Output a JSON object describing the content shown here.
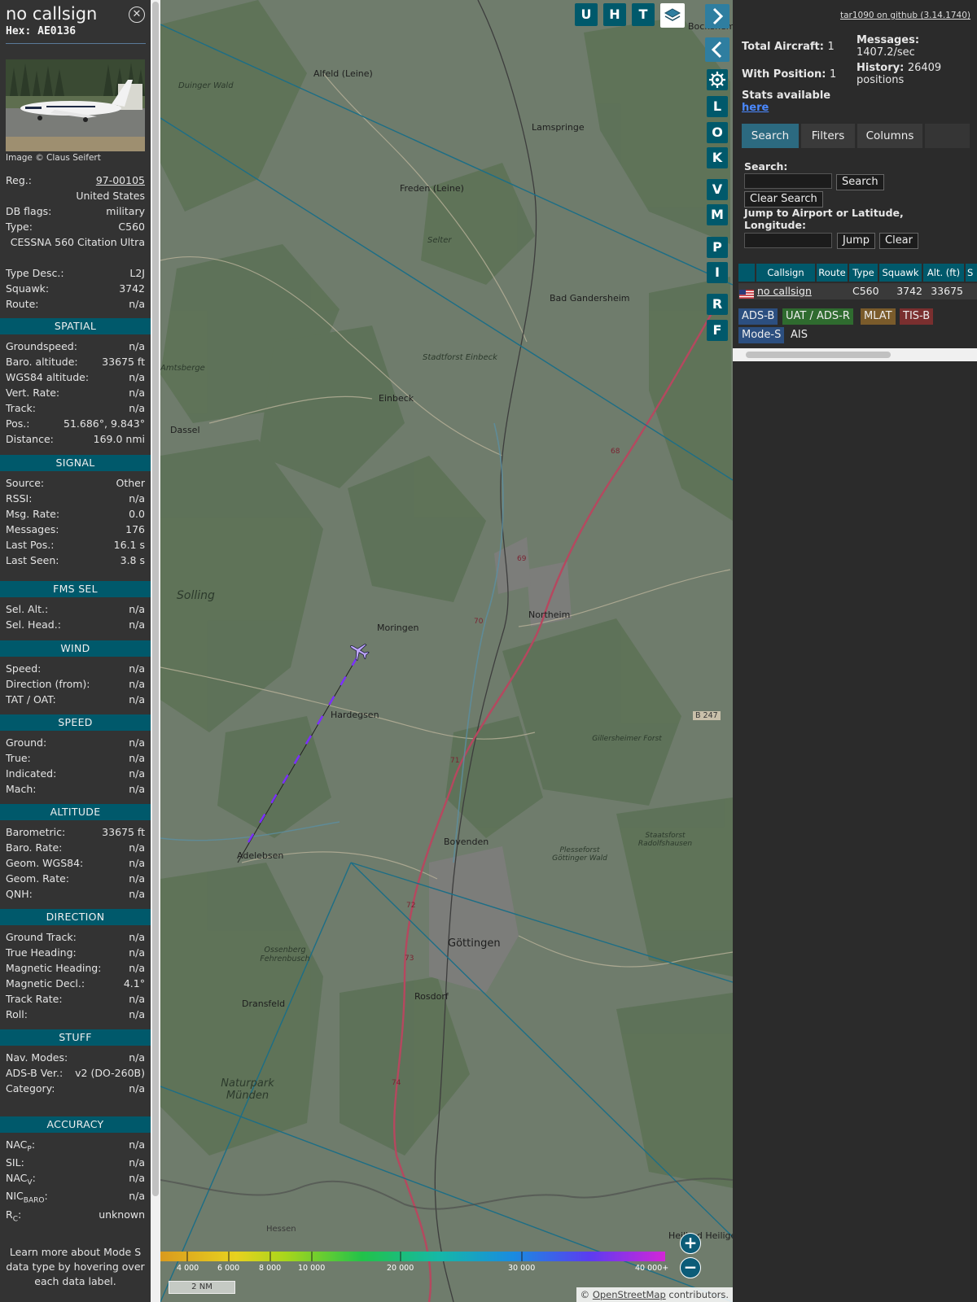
{
  "info": {
    "callsign": "no callsign",
    "hex": "Hex: AE0136",
    "photo_credit": "Image © Claus Seifert",
    "reg_label": "Reg.:",
    "reg_value": "97-00105",
    "country": "United States",
    "dbflags_label": "DB flags:",
    "dbflags_value": "military",
    "type_label": "Type:",
    "type_value": "C560",
    "type_full": "CESSNA 560 Citation Ultra",
    "typedesc_label": "Type Desc.:",
    "typedesc_value": "L2J",
    "squawk_label": "Squawk:",
    "squawk_value": "3742",
    "route_label": "Route:",
    "route_value": "n/a"
  },
  "sections": {
    "spatial": "SPATIAL",
    "signal": "SIGNAL",
    "fmssel": "FMS SEL",
    "wind": "WIND",
    "speed": "SPEED",
    "altitude": "ALTITUDE",
    "direction": "DIRECTION",
    "stuff": "STUFF",
    "accuracy": "ACCURACY"
  },
  "spatial": [
    {
      "label": "Groundspeed:",
      "value": "n/a"
    },
    {
      "label": "Baro. altitude:",
      "value": "33675 ft"
    },
    {
      "label": "WGS84 altitude:",
      "value": "n/a"
    },
    {
      "label": "Vert. Rate:",
      "value": "n/a"
    },
    {
      "label": "Track:",
      "value": "n/a"
    },
    {
      "label": "Pos.:",
      "value": "51.686°, 9.843°"
    },
    {
      "label": "Distance:",
      "value": "169.0 nmi"
    }
  ],
  "signal": [
    {
      "label": "Source:",
      "value": "Other"
    },
    {
      "label": "RSSI:",
      "value": "n/a"
    },
    {
      "label": "Msg. Rate:",
      "value": "0.0"
    },
    {
      "label": "Messages:",
      "value": "176"
    },
    {
      "label": "Last Pos.:",
      "value": "16.1 s"
    },
    {
      "label": "Last Seen:",
      "value": "3.8 s"
    }
  ],
  "fmssel": [
    {
      "label": "Sel. Alt.:",
      "value": "n/a"
    },
    {
      "label": "Sel. Head.:",
      "value": "n/a"
    }
  ],
  "wind": [
    {
      "label": "Speed:",
      "value": "n/a"
    },
    {
      "label": "Direction (from):",
      "value": "n/a"
    },
    {
      "label": "TAT / OAT:",
      "value": "n/a"
    }
  ],
  "speed": [
    {
      "label": "Ground:",
      "value": "n/a"
    },
    {
      "label": "True:",
      "value": "n/a"
    },
    {
      "label": "Indicated:",
      "value": "n/a"
    },
    {
      "label": "Mach:",
      "value": "n/a"
    }
  ],
  "altitude": [
    {
      "label": "Barometric:",
      "value": "33675 ft"
    },
    {
      "label": "Baro. Rate:",
      "value": "n/a"
    },
    {
      "label": "Geom. WGS84:",
      "value": "n/a"
    },
    {
      "label": "Geom. Rate:",
      "value": "n/a"
    },
    {
      "label": "QNH:",
      "value": "n/a"
    }
  ],
  "direction": [
    {
      "label": "Ground Track:",
      "value": "n/a"
    },
    {
      "label": "True Heading:",
      "value": "n/a"
    },
    {
      "label": "Magnetic Heading:",
      "value": "n/a"
    },
    {
      "label": "Magnetic Decl.:",
      "value": "4.1°"
    },
    {
      "label": "Track Rate:",
      "value": "n/a"
    },
    {
      "label": "Roll:",
      "value": "n/a"
    }
  ],
  "stuff": [
    {
      "label": "Nav. Modes:",
      "value": "n/a"
    },
    {
      "label": "ADS-B Ver.:",
      "value": "v2 (DO-260B)"
    },
    {
      "label": "Category:",
      "value": "n/a"
    }
  ],
  "accuracy": {
    "nacp_label": "NAC",
    "nacp_sub": "P",
    "nacp_value": "n/a",
    "sil_label": "SIL:",
    "sil_value": "n/a",
    "nacv_label": "NAC",
    "nacv_sub": "V",
    "nacv_value": "n/a",
    "nicbaro_label": "NIC",
    "nicbaro_sub": "BARO",
    "nicbaro_value": "n/a",
    "rc_label": "R",
    "rc_sub": "C",
    "rc_value": "unknown"
  },
  "learn_more": [
    "Learn more about Mode S",
    "data type by hovering over",
    "each data label."
  ],
  "map": {
    "top_buttons": [
      "U",
      "H",
      "T"
    ],
    "side_buttons": [
      "L",
      "O",
      "K",
      "V",
      "M",
      "P",
      "I",
      "R",
      "F"
    ],
    "scale": "2 NM",
    "attribution_prefix": "© ",
    "attribution_link": "OpenStreetMap",
    "attribution_suffix": " contributors.",
    "altitude_legend": [
      "4 000",
      "6 000",
      "8 000",
      "10 000",
      "20 000",
      "30 000",
      "40 000+"
    ],
    "places": [
      {
        "name": "Alfeld (Leine)"
      },
      {
        "name": "Duinger Wald"
      },
      {
        "name": "Lamspringe"
      },
      {
        "name": "Freden (Leine)"
      },
      {
        "name": "Selter"
      },
      {
        "name": "Bad Gandersheim"
      },
      {
        "name": "Stadtforst Einbeck"
      },
      {
        "name": "Amtsberge"
      },
      {
        "name": "Einbeck"
      },
      {
        "name": "Dassel"
      },
      {
        "name": "Solling"
      },
      {
        "name": "Moringen"
      },
      {
        "name": "Northeim"
      },
      {
        "name": "Hardegsen"
      },
      {
        "name": "B 247"
      },
      {
        "name": "Gillersheimer Forst"
      },
      {
        "name": "Bovenden"
      },
      {
        "name": "Adelebsen"
      },
      {
        "name": "Staatsforst Radolfshausen"
      },
      {
        "name": "Plesseforst Göttinger Wald"
      },
      {
        "name": "Göttingen"
      },
      {
        "name": "Ossenberg Fehrenbusch"
      },
      {
        "name": "Rosdorf"
      },
      {
        "name": "Dransfeld"
      },
      {
        "name": "Naturpark Münden"
      },
      {
        "name": "Hessen"
      },
      {
        "name": "Heilbad Heilige"
      },
      {
        "name": "Bockenem"
      },
      {
        "name": "68"
      },
      {
        "name": "69"
      },
      {
        "name": "70"
      },
      {
        "name": "71"
      },
      {
        "name": "72"
      },
      {
        "name": "73"
      },
      {
        "name": "74"
      }
    ]
  },
  "right": {
    "github_link": "tar1090 on github (3.14.1740)",
    "total_aircraft_label": "Total Aircraft:",
    "total_aircraft_value": "1",
    "with_position_label": "With Position:",
    "with_position_value": "1",
    "messages_label": "Messages:",
    "messages_value": "1407.2/sec",
    "history_label": "History:",
    "history_value": "26409",
    "history_unit": "positions",
    "stats_text": "Stats available",
    "stats_link": "here",
    "tabs": [
      "Search",
      "Filters",
      "Columns"
    ],
    "search_label": "Search:",
    "search_button": "Search",
    "clear_search_button": "Clear Search",
    "jump_label": "Jump to Airport or Latitude, Longitude:",
    "jump_button": "Jump",
    "clear_button": "Clear",
    "table_headers": [
      "Callsign",
      "Route",
      "Type",
      "Squawk",
      "Alt. (ft)",
      "S"
    ],
    "table_row": {
      "callsign": "no callsign",
      "route": "",
      "type": "C560",
      "squawk": "3742",
      "alt": "33675"
    },
    "badges": [
      {
        "label": "ADS-B",
        "color": "#2c4f80"
      },
      {
        "label": "UAT / ADS-R",
        "color": "#2f6b2f"
      },
      {
        "label": "MLAT",
        "color": "#7a5b2b"
      },
      {
        "label": "TIS-B",
        "color": "#7a2f2f"
      },
      {
        "label": "Mode-S",
        "color": "#2c4f80"
      },
      {
        "label": "AIS",
        "color": "transparent"
      }
    ]
  },
  "colors": {
    "section_bg": "#00596b",
    "map_bg": "#6b786b",
    "track": "#7b2fff",
    "accent": "#2c6a80"
  }
}
